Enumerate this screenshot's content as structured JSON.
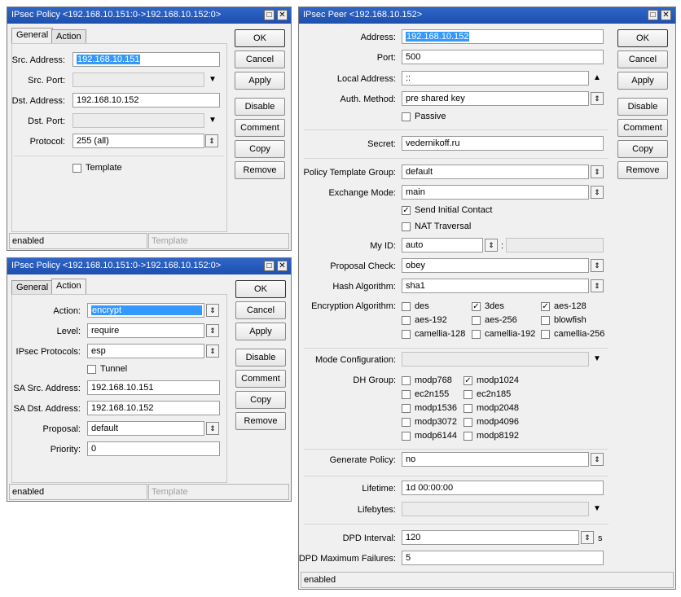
{
  "policy1": {
    "title": "IPsec Policy <192.168.10.151:0->192.168.10.152:0>",
    "tabs": [
      "General",
      "Action"
    ],
    "src_address_label": "Src. Address:",
    "src_address": "192.168.10.151",
    "src_port_label": "Src. Port:",
    "dst_address_label": "Dst. Address:",
    "dst_address": "192.168.10.152",
    "dst_port_label": "Dst. Port:",
    "protocol_label": "Protocol:",
    "protocol": "255 (all)",
    "template_label": "Template",
    "status_left": "enabled",
    "status_right": "Template"
  },
  "policy2": {
    "title": "IPsec Policy <192.168.10.151:0->192.168.10.152:0>",
    "tabs": [
      "General",
      "Action"
    ],
    "action_label": "Action:",
    "action": "encrypt",
    "level_label": "Level:",
    "level": "require",
    "protocols_label": "IPsec Protocols:",
    "protocols": "esp",
    "tunnel_label": "Tunnel",
    "sa_src_label": "SA Src. Address:",
    "sa_src": "192.168.10.151",
    "sa_dst_label": "SA Dst. Address:",
    "sa_dst": "192.168.10.152",
    "proposal_label": "Proposal:",
    "proposal": "default",
    "priority_label": "Priority:",
    "priority": "0",
    "status_left": "enabled",
    "status_right": "Template"
  },
  "buttons": {
    "ok": "OK",
    "cancel": "Cancel",
    "apply": "Apply",
    "disable": "Disable",
    "comment": "Comment",
    "copy": "Copy",
    "remove": "Remove"
  },
  "peer": {
    "title": "IPsec Peer <192.168.10.152>",
    "address_label": "Address:",
    "address": "192.168.10.152",
    "port_label": "Port:",
    "port": "500",
    "local_address_label": "Local Address:",
    "local_address": "::",
    "auth_method_label": "Auth. Method:",
    "auth_method": "pre shared key",
    "passive_label": "Passive",
    "secret_label": "Secret:",
    "secret": "vedernikoff.ru",
    "template_group_label": "Policy Template Group:",
    "template_group": "default",
    "exchange_mode_label": "Exchange Mode:",
    "exchange_mode": "main",
    "send_initial_contact_label": "Send Initial Contact",
    "nat_traversal_label": "NAT Traversal",
    "my_id_label": "My ID:",
    "my_id": "auto",
    "my_id_sep": ":",
    "proposal_check_label": "Proposal Check:",
    "proposal_check": "obey",
    "hash_label": "Hash Algorithm:",
    "hash": "sha1",
    "enc_label": "Encryption Algorithm:",
    "enc": [
      {
        "name": "des",
        "checked": false
      },
      {
        "name": "3des",
        "checked": true
      },
      {
        "name": "aes-128",
        "checked": true
      },
      {
        "name": "aes-192",
        "checked": false
      },
      {
        "name": "aes-256",
        "checked": false
      },
      {
        "name": "blowfish",
        "checked": false
      },
      {
        "name": "camellia-128",
        "checked": false
      },
      {
        "name": "camellia-192",
        "checked": false
      },
      {
        "name": "camellia-256",
        "checked": false
      }
    ],
    "mode_config_label": "Mode Configuration:",
    "dh_label": "DH Group:",
    "dh": [
      {
        "name": "modp768",
        "checked": false
      },
      {
        "name": "modp1024",
        "checked": true
      },
      {
        "name": "ec2n155",
        "checked": false
      },
      {
        "name": "ec2n185",
        "checked": false
      },
      {
        "name": "modp1536",
        "checked": false
      },
      {
        "name": "modp2048",
        "checked": false
      },
      {
        "name": "modp3072",
        "checked": false
      },
      {
        "name": "modp4096",
        "checked": false
      },
      {
        "name": "modp6144",
        "checked": false
      },
      {
        "name": "modp8192",
        "checked": false
      }
    ],
    "generate_policy_label": "Generate Policy:",
    "generate_policy": "no",
    "lifetime_label": "Lifetime:",
    "lifetime": "1d 00:00:00",
    "lifebytes_label": "Lifebytes:",
    "dpd_interval_label": "DPD Interval:",
    "dpd_interval": "120",
    "dpd_unit": "s",
    "dpd_max_label": "DPD Maximum Failures:",
    "dpd_max": "5",
    "status": "enabled"
  },
  "icons": {
    "minimize": "□",
    "close": "✕",
    "dropdown": "▼",
    "dropdown_up": "▲",
    "spin": "⇕",
    "check": "✓"
  }
}
